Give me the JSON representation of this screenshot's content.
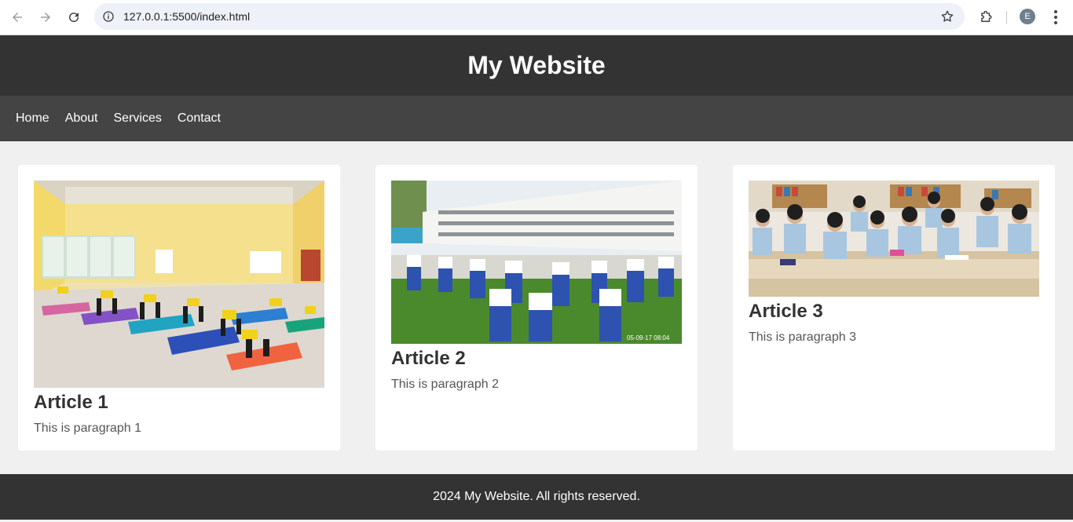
{
  "browser": {
    "url": "127.0.0.1:5500/index.html",
    "profile_initial": "E",
    "icons": [
      "back-icon",
      "forward-icon",
      "reload-icon",
      "site-info-icon",
      "bookmark-star-icon",
      "extensions-icon",
      "kebab-menu-icon"
    ]
  },
  "header": {
    "title": "My Website"
  },
  "nav": {
    "items": [
      {
        "label": "Home"
      },
      {
        "label": "About"
      },
      {
        "label": "Services"
      },
      {
        "label": "Contact"
      }
    ]
  },
  "articles": [
    {
      "title": "Article 1",
      "paragraph": "This is paragraph 1",
      "image": "yoga-class-photo"
    },
    {
      "title": "Article 2",
      "paragraph": "This is paragraph 2",
      "image": "school-assembly-photo"
    },
    {
      "title": "Article 3",
      "paragraph": "This is paragraph 3",
      "image": "classroom-students-photo"
    }
  ],
  "photo_timestamp": "05-09-17 08:04",
  "footer": {
    "text": "2024 My Website. All rights reserved."
  },
  "colors": {
    "header_bg": "#333333",
    "nav_bg": "#444444",
    "page_bg": "#f0f0f0",
    "card_bg": "#ffffff",
    "footer_bg": "#333333"
  }
}
